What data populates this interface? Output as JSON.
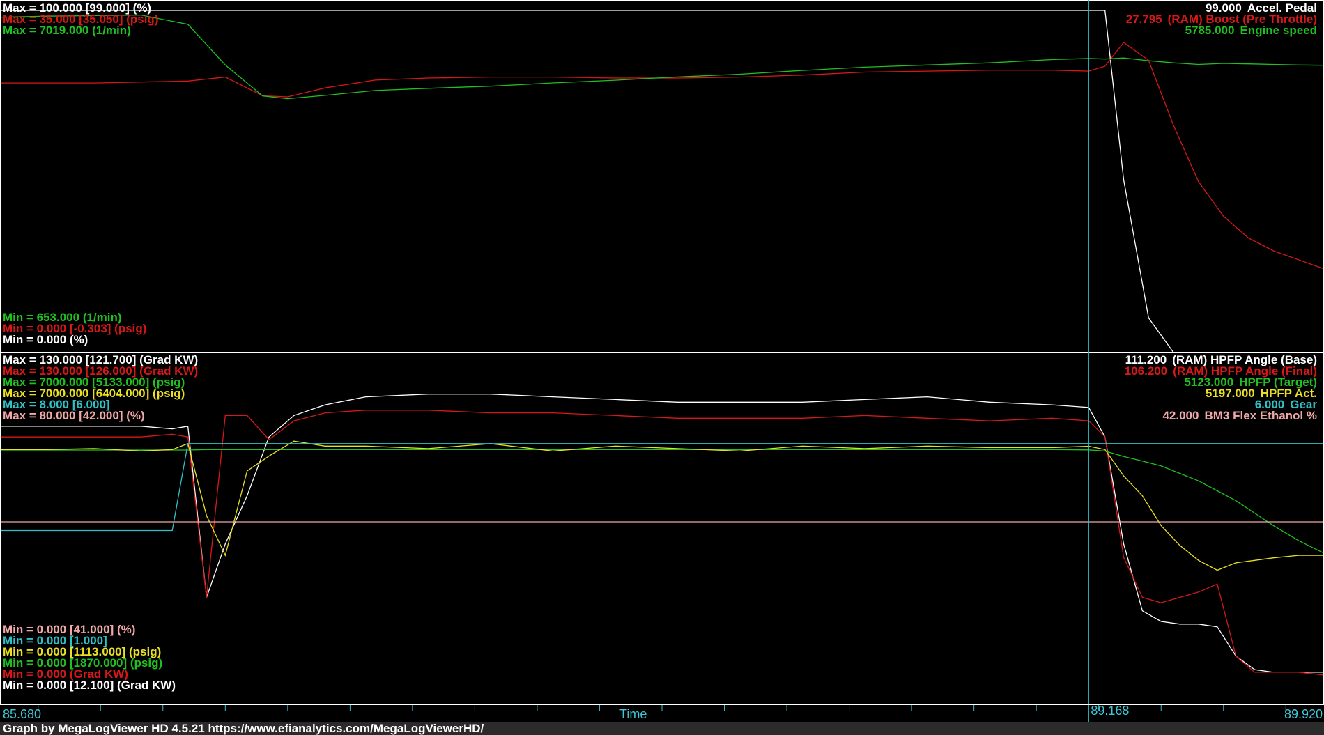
{
  "colors": {
    "white": "#ffffff",
    "red": "#d81818",
    "green": "#20c020",
    "yellow": "#e8e020",
    "cyan": "#30c0c8",
    "pink": "#f0a8a8"
  },
  "top_labels_left": [
    {
      "id": "tl-max-pedal",
      "text": "Max = 100.000 [99.000] (%)",
      "color": "white"
    },
    {
      "id": "tl-max-boost",
      "text": "Max = 35.000 [35.050] (psig)",
      "color": "red"
    },
    {
      "id": "tl-max-rpm",
      "text": "Max = 7019.000 (1/min)",
      "color": "green"
    }
  ],
  "top_labels_left_min": [
    {
      "id": "tl-min-rpm",
      "text": "Min = 653.000 (1/min)",
      "color": "green"
    },
    {
      "id": "tl-min-boost",
      "text": "Min = 0.000 [-0.303] (psig)",
      "color": "red"
    },
    {
      "id": "tl-min-pedal",
      "text": "Min = 0.000 (%)",
      "color": "white"
    }
  ],
  "top_labels_right": [
    {
      "id": "tr-pedal",
      "value": "99.000",
      "name": "Accel. Pedal",
      "color": "white"
    },
    {
      "id": "tr-boost",
      "value": "27.795",
      "name": "(RAM) Boost (Pre Throttle)",
      "color": "red"
    },
    {
      "id": "tr-rpm",
      "value": "5785.000",
      "name": "Engine speed",
      "color": "green"
    }
  ],
  "bottom_labels_left": [
    {
      "id": "bl-max-base",
      "text": "Max = 130.000 [121.700] (Grad KW)",
      "color": "white"
    },
    {
      "id": "bl-max-final",
      "text": "Max = 130.000 [126.000] (Grad KW)",
      "color": "red"
    },
    {
      "id": "bl-max-target",
      "text": "Max = 7000.000 [5133.000] (psig)",
      "color": "green"
    },
    {
      "id": "bl-max-act",
      "text": "Max = 7000.000 [6404.000] (psig)",
      "color": "yellow"
    },
    {
      "id": "bl-max-gear",
      "text": "Max = 8.000 [6.000]",
      "color": "cyan"
    },
    {
      "id": "bl-max-eth",
      "text": "Max = 80.000 [42.000] (%)",
      "color": "pink"
    }
  ],
  "bottom_labels_left_min": [
    {
      "id": "bl-min-eth",
      "text": "Min = 0.000 [41.000] (%)",
      "color": "pink"
    },
    {
      "id": "bl-min-gear",
      "text": "Min = 0.000 [1.000]",
      "color": "cyan"
    },
    {
      "id": "bl-min-act",
      "text": "Min = 0.000 [1113.000] (psig)",
      "color": "yellow"
    },
    {
      "id": "bl-min-target",
      "text": "Min = 0.000 [1870.000] (psig)",
      "color": "green"
    },
    {
      "id": "bl-min-final",
      "text": "Min = 0.000 (Grad KW)",
      "color": "red"
    },
    {
      "id": "bl-min-base",
      "text": "Min = 0.000 [12.100] (Grad KW)",
      "color": "white"
    }
  ],
  "bottom_labels_right": [
    {
      "id": "br-base",
      "value": "111.200",
      "name": "(RAM) HPFP Angle (Base)",
      "color": "white"
    },
    {
      "id": "br-final",
      "value": "106.200",
      "name": "(RAM) HPFP Angle (Final)",
      "color": "red"
    },
    {
      "id": "br-target",
      "value": "5123.000",
      "name": "HPFP (Target)",
      "color": "green"
    },
    {
      "id": "br-act",
      "value": "5197.000",
      "name": "HPFP Act.",
      "color": "yellow"
    },
    {
      "id": "br-gear",
      "value": "6.000",
      "name": "Gear",
      "color": "cyan"
    },
    {
      "id": "br-eth",
      "value": "42.000",
      "name": "BM3 Flex Ethanol %",
      "color": "pink"
    }
  ],
  "axis": {
    "start": "85.680",
    "end": "89.920",
    "label": "Time",
    "cursor": "89.168",
    "cursor_value": 89.168
  },
  "footer": {
    "text": "Graph by MegaLogViewer HD 4.5.21 https://www.efianalytics.com/MegaLogViewerHD/"
  },
  "chart_data": [
    {
      "type": "line",
      "xlabel": "Time",
      "xlim": [
        85.68,
        89.92
      ],
      "x": [
        85.68,
        85.83,
        85.98,
        86.13,
        86.28,
        86.4,
        86.52,
        86.6,
        86.72,
        86.88,
        87.05,
        87.25,
        87.45,
        87.65,
        87.85,
        88.05,
        88.25,
        88.45,
        88.65,
        88.85,
        89.05,
        89.168,
        89.22,
        89.28,
        89.36,
        89.44,
        89.52,
        89.6,
        89.68,
        89.76,
        89.84,
        89.92
      ],
      "series": [
        {
          "name": "Accel. Pedal",
          "color": "white",
          "ylim": [
            0,
            100
          ],
          "values": [
            99,
            99,
            99,
            99,
            99,
            99,
            99,
            99,
            99,
            99,
            99,
            99,
            99,
            99,
            99,
            99,
            99,
            99,
            99,
            99,
            99,
            99,
            99,
            50,
            10,
            0,
            0,
            0,
            0,
            0,
            0,
            0
          ]
        },
        {
          "name": "(RAM) Boost (Pre Throttle)",
          "color": "red",
          "ylim": [
            0,
            35
          ],
          "values": [
            27.3,
            27.3,
            27.3,
            27.4,
            27.5,
            27.9,
            26.0,
            25.9,
            26.8,
            27.6,
            27.8,
            27.9,
            27.9,
            27.8,
            27.8,
            27.9,
            28.1,
            28.4,
            28.5,
            28.6,
            28.6,
            28.5,
            29.0,
            31.4,
            29.6,
            23.0,
            17.3,
            13.8,
            11.6,
            10.3,
            9.4,
            8.5
          ]
        },
        {
          "name": "Engine speed",
          "color": "green",
          "ylim": [
            653,
            7019
          ],
          "values": [
            6830,
            6850,
            6860,
            6870,
            6700,
            5950,
            5380,
            5330,
            5390,
            5480,
            5520,
            5560,
            5620,
            5670,
            5730,
            5780,
            5850,
            5910,
            5950,
            5990,
            6050,
            6070,
            6060,
            6080,
            6030,
            5990,
            5960,
            5980,
            5970,
            5960,
            5950,
            5945
          ]
        }
      ]
    },
    {
      "type": "line",
      "xlabel": "Time",
      "xlim": [
        85.68,
        89.92
      ],
      "x": [
        85.68,
        85.83,
        85.98,
        86.13,
        86.23,
        86.28,
        86.34,
        86.4,
        86.47,
        86.54,
        86.62,
        86.72,
        86.85,
        87.05,
        87.25,
        87.45,
        87.65,
        87.85,
        88.05,
        88.25,
        88.45,
        88.65,
        88.85,
        89.05,
        89.168,
        89.22,
        89.28,
        89.34,
        89.4,
        89.46,
        89.52,
        89.58,
        89.64,
        89.7,
        89.76,
        89.84,
        89.92
      ],
      "series": [
        {
          "name": "(RAM) HPFP Angle (Base)",
          "color": "white",
          "ylim": [
            0,
            130
          ],
          "values": [
            104,
            104,
            104,
            104,
            103,
            104,
            40,
            60,
            78,
            100,
            108,
            112,
            115,
            116,
            116,
            115,
            114,
            113,
            113,
            113,
            114,
            115,
            113,
            112,
            111,
            100,
            60,
            35,
            31,
            30,
            30,
            29,
            18,
            13,
            12,
            12,
            12
          ]
        },
        {
          "name": "(RAM) HPFP Angle (Final)",
          "color": "red",
          "ylim": [
            0,
            130
          ],
          "values": [
            100,
            100,
            100,
            100,
            101,
            100,
            40,
            108,
            108,
            99,
            106,
            109,
            110,
            110,
            109,
            109,
            108,
            107,
            107,
            107,
            108,
            107,
            106,
            107,
            106,
            100,
            55,
            40,
            38,
            40,
            42,
            45,
            18,
            12,
            12,
            12,
            11
          ]
        },
        {
          "name": "HPFP (Target)",
          "color": "green",
          "ylim": [
            0,
            7000
          ],
          "values": [
            5120,
            5120,
            5120,
            5120,
            5120,
            5120,
            5130,
            5130,
            5130,
            5130,
            5130,
            5130,
            5130,
            5130,
            5130,
            5130,
            5130,
            5130,
            5130,
            5130,
            5130,
            5130,
            5130,
            5130,
            5123,
            5100,
            4990,
            4900,
            4800,
            4650,
            4500,
            4300,
            4100,
            3850,
            3600,
            3300,
            3050
          ]
        },
        {
          "name": "HPFP Act.",
          "color": "yellow",
          "ylim": [
            0,
            7000
          ],
          "values": [
            5130,
            5130,
            5150,
            5100,
            5130,
            5250,
            3800,
            3000,
            4700,
            5000,
            5300,
            5200,
            5200,
            5150,
            5250,
            5100,
            5200,
            5150,
            5100,
            5200,
            5150,
            5200,
            5170,
            5170,
            5197,
            5130,
            4600,
            4200,
            3600,
            3200,
            2900,
            2700,
            2850,
            2900,
            2950,
            3000,
            3000
          ]
        },
        {
          "name": "Gear",
          "color": "cyan",
          "ylim": [
            0,
            8
          ],
          "values": [
            4,
            4,
            4,
            4,
            4,
            6,
            6,
            6,
            6,
            6,
            6,
            6,
            6,
            6,
            6,
            6,
            6,
            6,
            6,
            6,
            6,
            6,
            6,
            6,
            6,
            6,
            6,
            6,
            6,
            6,
            6,
            6,
            6,
            6,
            6,
            6,
            6
          ]
        },
        {
          "name": "BM3 Flex Ethanol %",
          "color": "pink",
          "ylim": [
            0,
            80
          ],
          "values": [
            42,
            42,
            42,
            42,
            42,
            42,
            42,
            42,
            42,
            42,
            42,
            42,
            42,
            42,
            42,
            42,
            42,
            42,
            42,
            42,
            42,
            42,
            42,
            42,
            42,
            42,
            42,
            42,
            42,
            42,
            42,
            42,
            42,
            42,
            42,
            42,
            42
          ]
        }
      ]
    }
  ]
}
